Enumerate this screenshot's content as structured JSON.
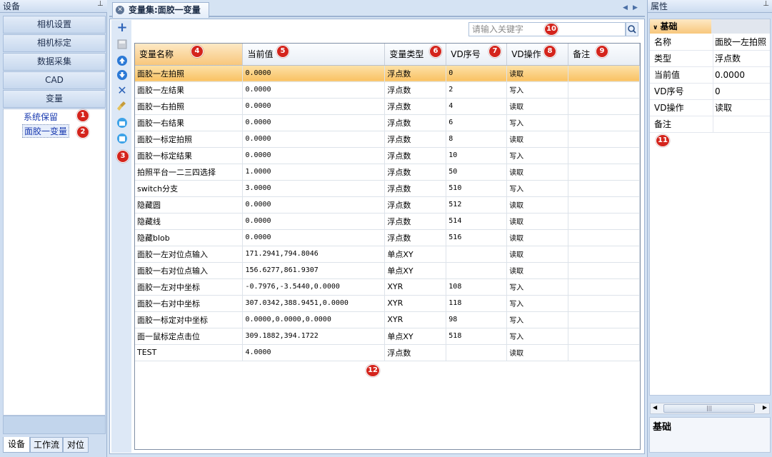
{
  "left_panel": {
    "title": "设备",
    "nav": [
      "相机设置",
      "相机标定",
      "数据采集",
      "CAD",
      "变量"
    ],
    "tree": [
      "系统保留",
      "面胶一变量"
    ],
    "bottom_tabs": [
      "设备",
      "工作流",
      "对位"
    ]
  },
  "document": {
    "tab_title": "变量集:面胶一变量",
    "search_placeholder": "请输入关键字"
  },
  "grid": {
    "columns": [
      "变量名称",
      "当前值",
      "变量类型",
      "VD序号",
      "VD操作",
      "备注"
    ],
    "rows": [
      [
        "面胶一左拍照",
        "0.0000",
        "浮点数",
        "0",
        "读取",
        ""
      ],
      [
        "面胶一左结果",
        "0.0000",
        "浮点数",
        "2",
        "写入",
        ""
      ],
      [
        "面胶一右拍照",
        "0.0000",
        "浮点数",
        "4",
        "读取",
        ""
      ],
      [
        "面胶一右结果",
        "0.0000",
        "浮点数",
        "6",
        "写入",
        ""
      ],
      [
        "面胶一标定拍照",
        "0.0000",
        "浮点数",
        "8",
        "读取",
        ""
      ],
      [
        "面胶一标定结果",
        "0.0000",
        "浮点数",
        "10",
        "写入",
        ""
      ],
      [
        "拍照平台一二三四选择",
        "1.0000",
        "浮点数",
        "50",
        "读取",
        ""
      ],
      [
        "switch分支",
        "3.0000",
        "浮点数",
        "510",
        "写入",
        ""
      ],
      [
        "隐藏圆",
        "0.0000",
        "浮点数",
        "512",
        "读取",
        ""
      ],
      [
        "隐藏线",
        "0.0000",
        "浮点数",
        "514",
        "读取",
        ""
      ],
      [
        "隐藏blob",
        "0.0000",
        "浮点数",
        "516",
        "读取",
        ""
      ],
      [
        "面胶一左对位点输入",
        "171.2941,794.8046",
        "单点XY",
        "",
        "读取",
        ""
      ],
      [
        "面胶一右对位点输入",
        "156.6277,861.9307",
        "单点XY",
        "",
        "读取",
        ""
      ],
      [
        "面胶一左对中坐标",
        "-0.7976,-3.5440,0.0000",
        "XYR",
        "108",
        "写入",
        ""
      ],
      [
        "面胶一右对中坐标",
        "307.0342,388.9451,0.0000",
        "XYR",
        "118",
        "写入",
        ""
      ],
      [
        "面胶一标定对中坐标",
        "0.0000,0.0000,0.0000",
        "XYR",
        "98",
        "写入",
        ""
      ],
      [
        "面一鼠标定点击位",
        "309.1882,394.1722",
        "单点XY",
        "518",
        "写入",
        ""
      ],
      [
        "TEST",
        "4.0000",
        "浮点数",
        "",
        "读取",
        ""
      ]
    ]
  },
  "properties": {
    "title": "属性",
    "category": "基础",
    "items": [
      {
        "key": "名称",
        "value": "面胶一左拍照"
      },
      {
        "key": "类型",
        "value": "浮点数"
      },
      {
        "key": "当前值",
        "value": "0.0000"
      },
      {
        "key": "VD序号",
        "value": "0"
      },
      {
        "key": "VD操作",
        "value": "读取"
      },
      {
        "key": "备注",
        "value": ""
      }
    ],
    "description_title": "基础"
  },
  "badges": [
    "1",
    "2",
    "3",
    "4",
    "5",
    "6",
    "7",
    "8",
    "9",
    "10",
    "11",
    "12"
  ]
}
